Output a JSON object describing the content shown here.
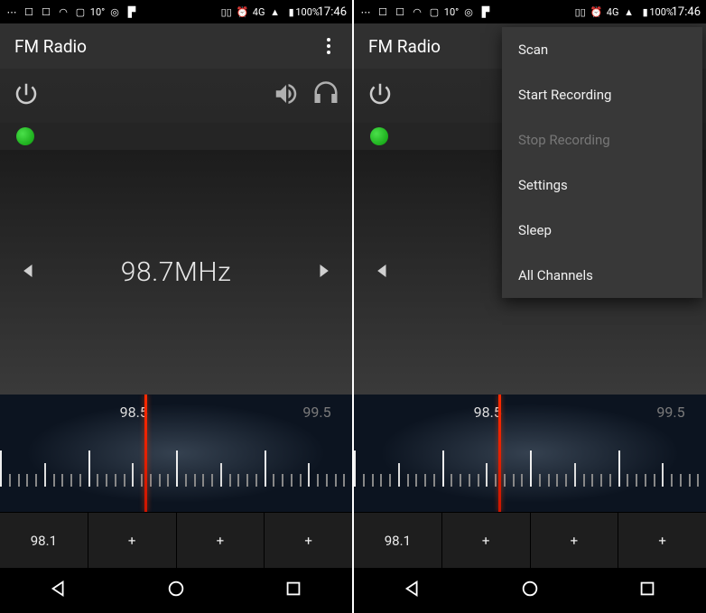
{
  "statusbar": {
    "temp": "10°",
    "net": "4G",
    "battery": "100%",
    "time": "17:46"
  },
  "app": {
    "title": "FM Radio"
  },
  "frequency": {
    "display": "98.7MHz",
    "display_partial": "98."
  },
  "dial": {
    "label_center": "98.5",
    "label_right": "99.5"
  },
  "presets": [
    {
      "label": "98.1"
    },
    {
      "label": "+"
    },
    {
      "label": "+"
    },
    {
      "label": "+"
    }
  ],
  "menu": {
    "items": [
      {
        "label": "Scan",
        "enabled": true
      },
      {
        "label": "Start Recording",
        "enabled": true
      },
      {
        "label": "Stop Recording",
        "enabled": false
      },
      {
        "label": "Settings",
        "enabled": true
      },
      {
        "label": "Sleep",
        "enabled": true
      },
      {
        "label": "All Channels",
        "enabled": true
      }
    ]
  }
}
